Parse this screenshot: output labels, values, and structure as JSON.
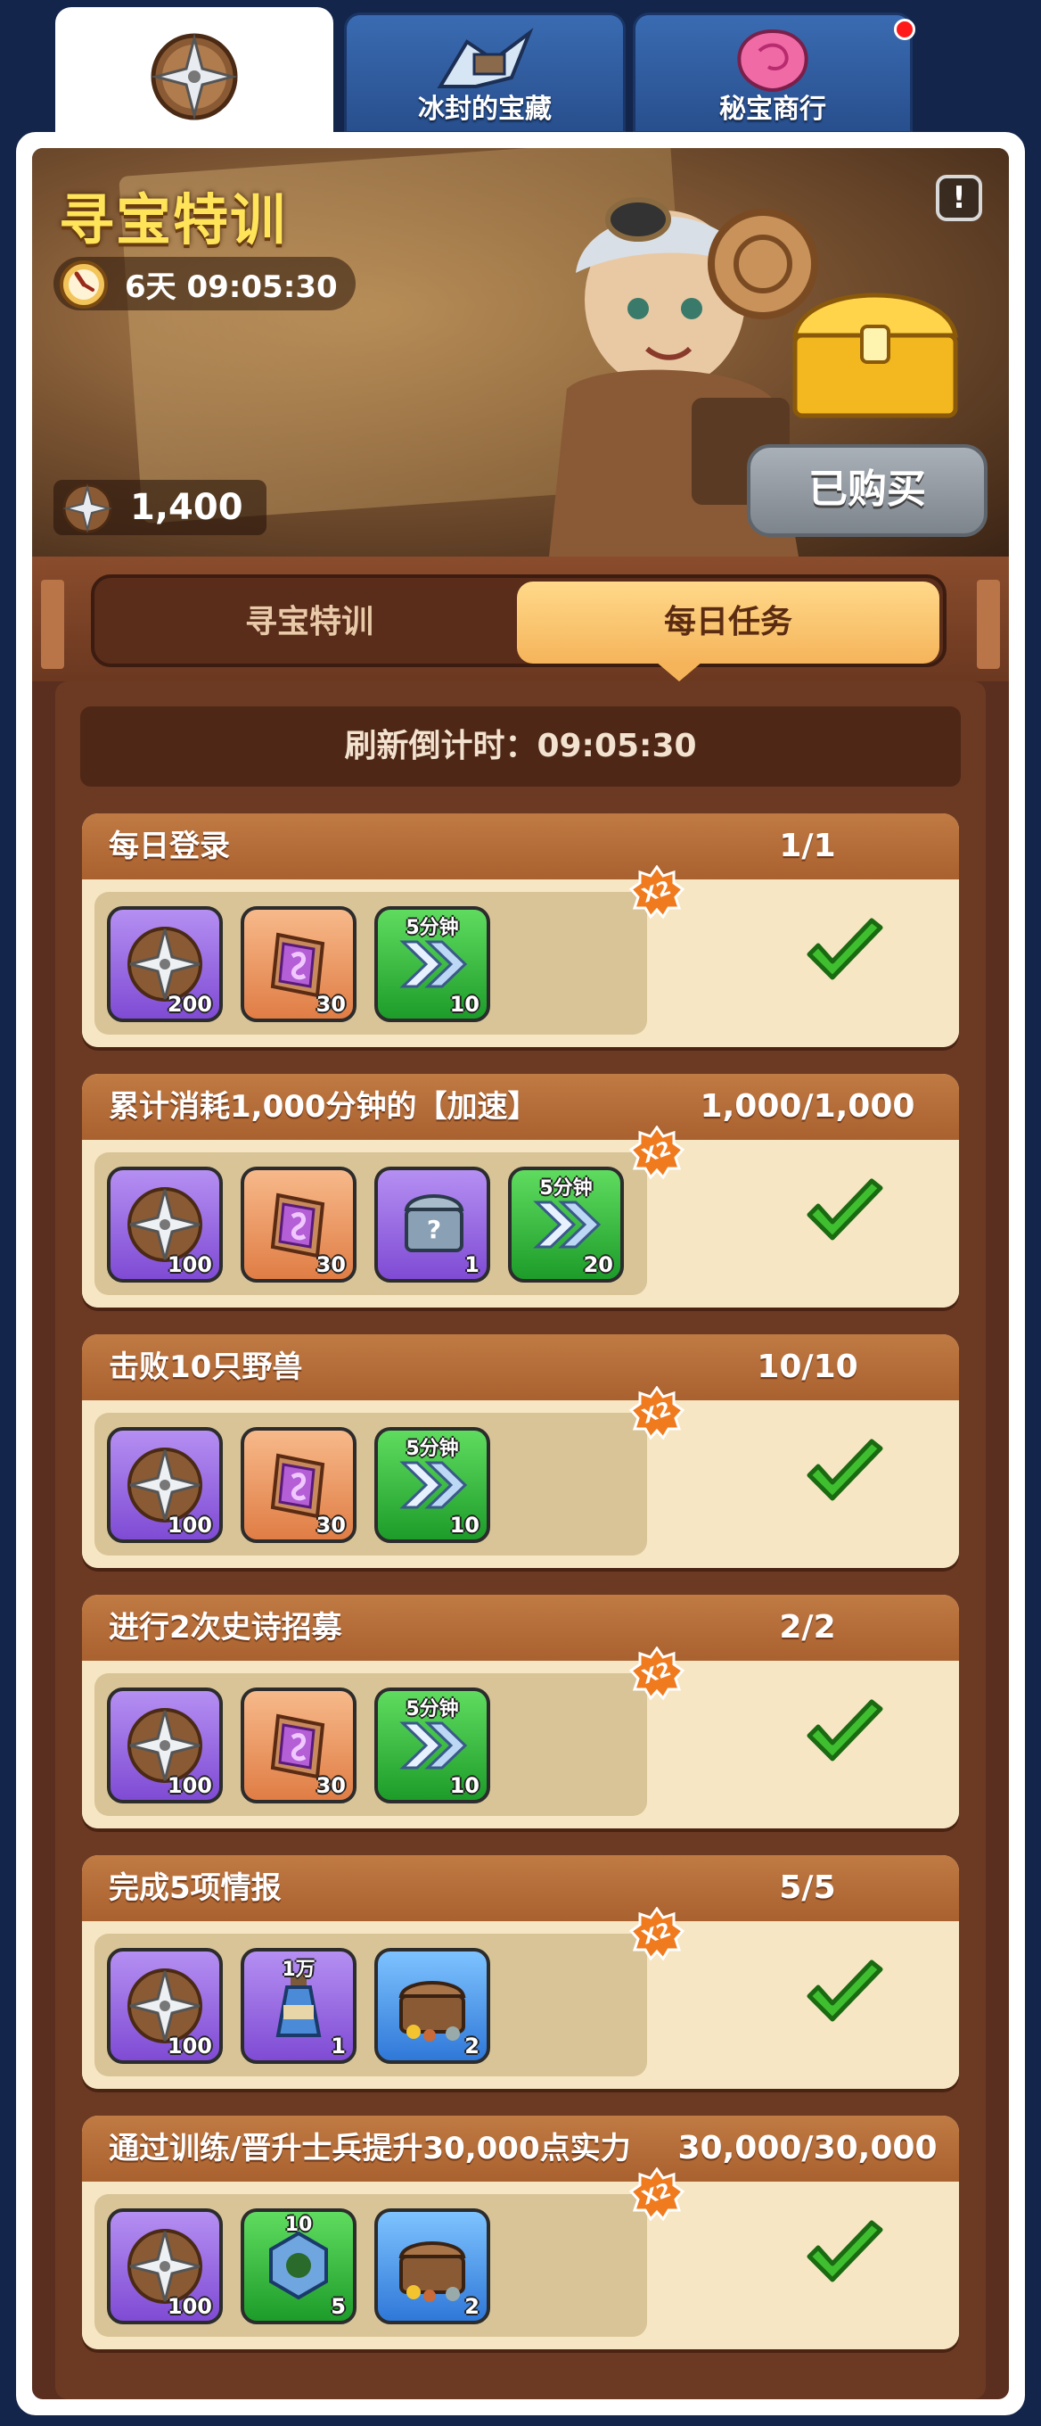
{
  "tabs": [
    {
      "label": "",
      "icon": "shuriken-compass-icon",
      "active": true
    },
    {
      "label": "冰封的宝藏",
      "icon": "frozen-treasure-icon",
      "active": false
    },
    {
      "label": "秘宝商行",
      "icon": "rose-gem-icon",
      "active": false,
      "has_notification": true
    }
  ],
  "banner": {
    "title": "寻宝特训",
    "timer": "6天 09:05:30",
    "currency_amount": "1,400",
    "info_label": "!",
    "purchased_label": "已购买"
  },
  "segments": {
    "left": "寻宝特训",
    "right": "每日任务",
    "selected": "right"
  },
  "refresh": {
    "text": "刷新倒计时：09:05:30"
  },
  "tasks": [
    {
      "title": "每日登录",
      "progress": "1/1",
      "multiplier": "X2",
      "completed": true,
      "rewards": [
        {
          "kind": "shuriken",
          "color": "purple",
          "count": "200"
        },
        {
          "kind": "scroll",
          "color": "orange",
          "count": "30"
        },
        {
          "kind": "speedup",
          "color": "green",
          "top": "5分钟",
          "count": "10"
        }
      ]
    },
    {
      "title": "累计消耗1,000分钟的【加速】",
      "progress": "1,000/1,000",
      "multiplier": "X2",
      "completed": true,
      "rewards": [
        {
          "kind": "shuriken",
          "color": "purple",
          "count": "100"
        },
        {
          "kind": "scroll",
          "color": "orange",
          "count": "30"
        },
        {
          "kind": "mystery-chest",
          "color": "purple",
          "count": "1"
        },
        {
          "kind": "speedup",
          "color": "green",
          "top": "5分钟",
          "count": "20"
        }
      ]
    },
    {
      "title": "击败10只野兽",
      "progress": "10/10",
      "multiplier": "X2",
      "completed": true,
      "rewards": [
        {
          "kind": "shuriken",
          "color": "purple",
          "count": "100"
        },
        {
          "kind": "scroll",
          "color": "orange",
          "count": "30"
        },
        {
          "kind": "speedup",
          "color": "green",
          "top": "5分钟",
          "count": "10"
        }
      ]
    },
    {
      "title": "进行2次史诗招募",
      "progress": "2/2",
      "multiplier": "X2",
      "completed": true,
      "rewards": [
        {
          "kind": "shuriken",
          "color": "purple",
          "count": "100"
        },
        {
          "kind": "scroll",
          "color": "orange",
          "count": "30"
        },
        {
          "kind": "speedup",
          "color": "green",
          "top": "5分钟",
          "count": "10"
        }
      ]
    },
    {
      "title": "完成5项情报",
      "progress": "5/5",
      "multiplier": "X2",
      "completed": true,
      "rewards": [
        {
          "kind": "shuriken",
          "color": "purple",
          "count": "100"
        },
        {
          "kind": "potion",
          "color": "purple",
          "top": "1万",
          "count": "1"
        },
        {
          "kind": "resource-chest",
          "color": "blue",
          "count": "2"
        }
      ]
    },
    {
      "title": "通过训练/晋升士兵提升30,000点实力",
      "progress": "30,000/30,000",
      "multiplier": "X2",
      "completed": true,
      "rewards": [
        {
          "kind": "shuriken",
          "color": "purple",
          "count": "100"
        },
        {
          "kind": "gear-nut",
          "color": "green",
          "top": "10",
          "count": "5"
        },
        {
          "kind": "resource-chest",
          "color": "blue",
          "count": "2"
        }
      ]
    }
  ],
  "colors": {
    "background": "#13254a",
    "title_gold": "#ffe45a",
    "tab_blue": "#3a6bb2",
    "segment_active": "#f5b45a",
    "check_green": "#39b52b",
    "badge_orange": "#f07a1e"
  }
}
